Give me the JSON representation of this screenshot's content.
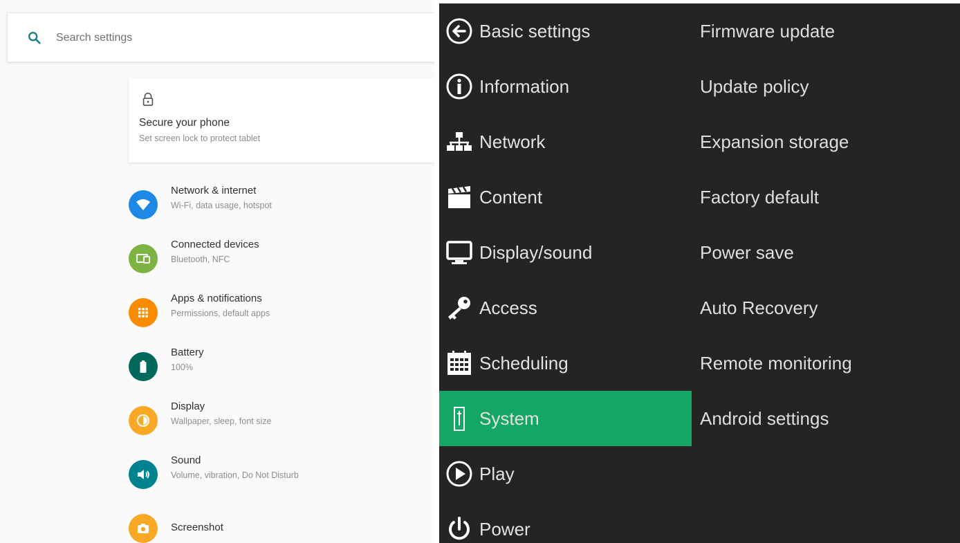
{
  "left_panel": {
    "search": {
      "placeholder": "Search settings",
      "icon": "search-icon",
      "accent": "#1a7f86"
    },
    "secure_card": {
      "icon": "lock-icon",
      "title": "Secure your phone",
      "subtitle": "Set screen lock to protect tablet"
    },
    "items": [
      {
        "title": "Network & internet",
        "subtitle": "Wi-Fi, data usage, hotspot",
        "icon": "wifi-icon",
        "color": "#1e88e5"
      },
      {
        "title": "Connected devices",
        "subtitle": "Bluetooth, NFC",
        "icon": "devices-icon",
        "color": "#7cb342"
      },
      {
        "title": "Apps & notifications",
        "subtitle": "Permissions, default apps",
        "icon": "apps-icon",
        "color": "#fb8c00"
      },
      {
        "title": "Battery",
        "subtitle": "100%",
        "icon": "battery-icon",
        "color": "#00695c"
      },
      {
        "title": "Display",
        "subtitle": "Wallpaper, sleep, font size",
        "icon": "brightness-icon",
        "color": "#f9a825"
      },
      {
        "title": "Sound",
        "subtitle": "Volume, vibration, Do Not Disturb",
        "icon": "volume-icon",
        "color": "#00838f"
      },
      {
        "title": "Screenshot",
        "subtitle": "",
        "icon": "camera-icon",
        "color": "#f9a825"
      }
    ]
  },
  "right_panel": {
    "accent": "#14a664",
    "menu": [
      {
        "label": "Basic settings",
        "icon": "back-arrow-icon"
      },
      {
        "label": "Information",
        "icon": "info-icon"
      },
      {
        "label": "Network",
        "icon": "network-icon"
      },
      {
        "label": "Content",
        "icon": "clapperboard-icon"
      },
      {
        "label": "Display/sound",
        "icon": "monitor-icon"
      },
      {
        "label": "Access",
        "icon": "key-icon"
      },
      {
        "label": "Scheduling",
        "icon": "calendar-icon"
      },
      {
        "label": "System",
        "icon": "system-icon",
        "selected": true
      },
      {
        "label": "Play",
        "icon": "play-icon"
      },
      {
        "label": "Power",
        "icon": "power-icon"
      }
    ],
    "submenu": [
      "Firmware update",
      "Update policy",
      "Expansion storage",
      "Factory default",
      "Power save",
      "Auto Recovery",
      "Remote monitoring",
      "Android settings"
    ]
  }
}
